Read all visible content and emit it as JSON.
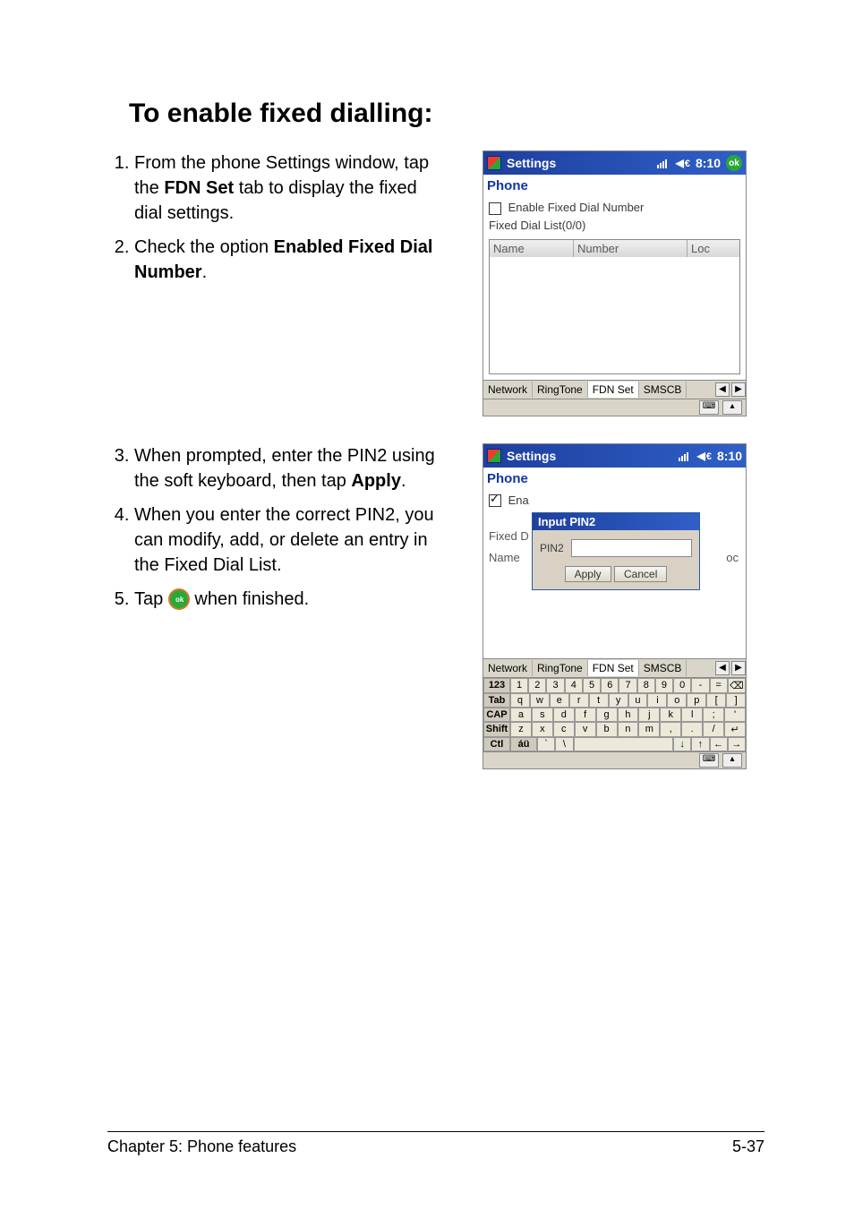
{
  "heading": "To enable fixed dialling:",
  "steps_a": [
    {
      "n": 1,
      "pre": "From the phone Settings window, tap the ",
      "b": "FDN Set",
      "post": " tab to display the fixed dial settings."
    },
    {
      "n": 2,
      "pre": "Check the option ",
      "b": "Enabled Fixed Dial Number",
      "post": "."
    }
  ],
  "steps_b": [
    {
      "n": 3,
      "pre": "When prompted, enter the PIN2 using the soft keyboard, then tap ",
      "b": "Apply",
      "post": "."
    },
    {
      "n": 4,
      "pre": "When you enter the correct PIN2, you can modify, add, or delete an entry in the Fixed Dial List.",
      "b": "",
      "post": ""
    },
    {
      "n": 5,
      "pre": "Tap ",
      "icon": "ok",
      "post": " when finished."
    }
  ],
  "ppc1": {
    "title": "Settings",
    "time": "8:10",
    "ok": "ok",
    "subtitle": "Phone",
    "checkbox_label": "Enable Fixed Dial Number",
    "list_label": "Fixed Dial List(0/0)",
    "columns": {
      "name": "Name",
      "number": "Number",
      "loc": "Loc"
    },
    "tabs": [
      "Network",
      "RingTone",
      "FDN Set",
      "SMSCB"
    ],
    "active_tab": "FDN Set"
  },
  "ppc2": {
    "title": "Settings",
    "time": "8:10",
    "subtitle": "Phone",
    "checked_prefix": "Ena",
    "dialog_title": "Input PIN2",
    "left_line1": "Fixed D",
    "left_line2": "Name",
    "pin_label": "PIN2",
    "right_clip": "oc",
    "apply": "Apply",
    "cancel": "Cancel",
    "tabs": [
      "Network",
      "RingTone",
      "FDN Set",
      "SMSCB"
    ],
    "active_tab": "FDN Set",
    "kb": {
      "r0": [
        "123",
        "1",
        "2",
        "3",
        "4",
        "5",
        "6",
        "7",
        "8",
        "9",
        "0",
        "-",
        "=",
        "⌫"
      ],
      "r1": [
        "Tab",
        "q",
        "w",
        "e",
        "r",
        "t",
        "y",
        "u",
        "i",
        "o",
        "p",
        "[",
        "]"
      ],
      "r2": [
        "CAP",
        "a",
        "s",
        "d",
        "f",
        "g",
        "h",
        "j",
        "k",
        "l",
        ";",
        "'"
      ],
      "r3": [
        "Shift",
        "z",
        "x",
        "c",
        "v",
        "b",
        "n",
        "m",
        ",",
        ".",
        "/",
        "↵"
      ],
      "r4": [
        "Ctl",
        "áü",
        "`",
        "\\",
        " ",
        "↓",
        "↑",
        "←",
        "→"
      ]
    }
  },
  "footer": {
    "chapter": "Chapter 5: Phone features",
    "page": "5-37"
  }
}
